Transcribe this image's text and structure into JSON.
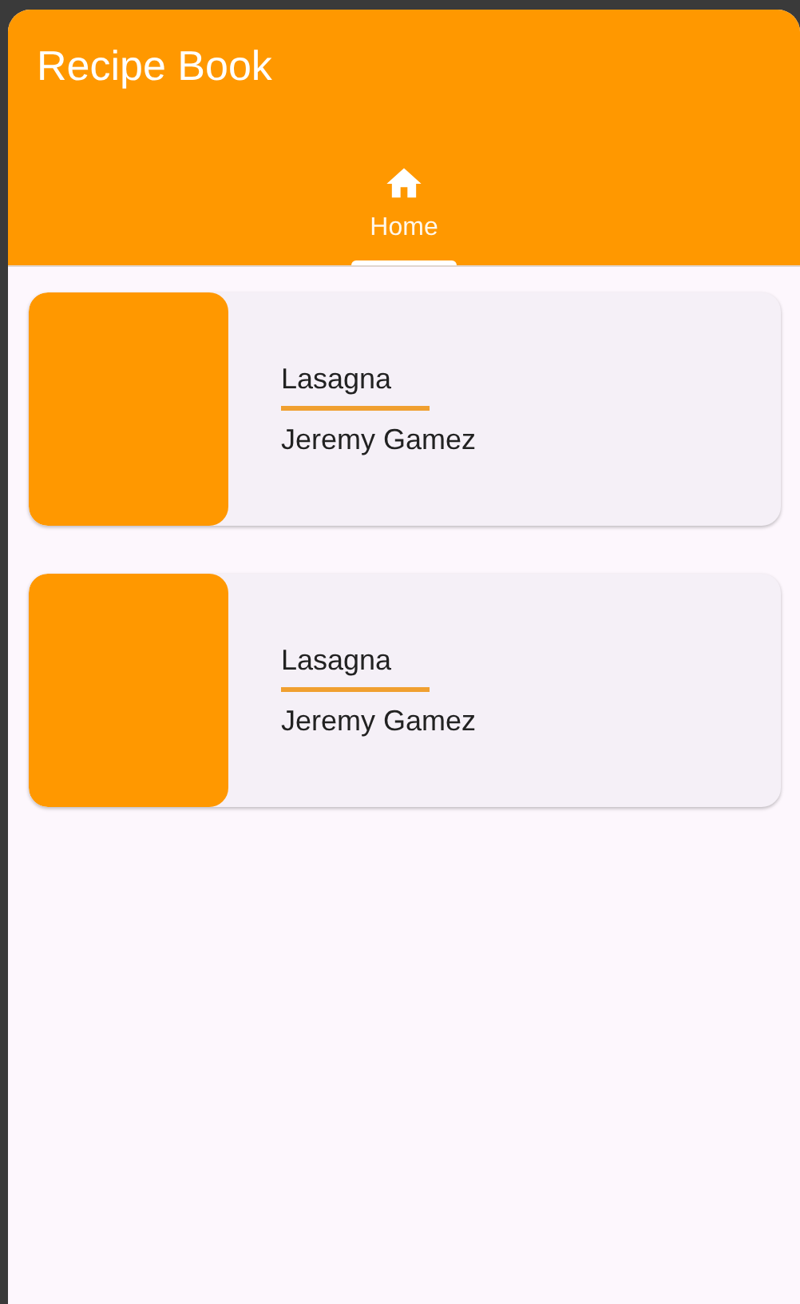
{
  "app_bar": {
    "title": "Recipe Book"
  },
  "tabs": [
    {
      "label": "Home",
      "selected": true
    }
  ],
  "recipes": [
    {
      "name": "Lasagna",
      "author": "Jeremy Gamez"
    },
    {
      "name": "Lasagna",
      "author": "Jeremy Gamez"
    }
  ]
}
